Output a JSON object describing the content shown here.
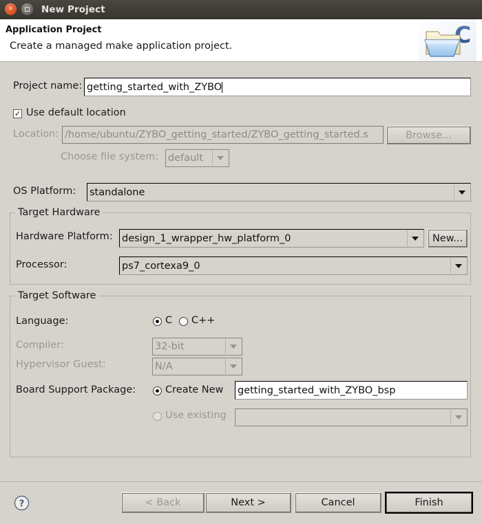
{
  "window": {
    "title": "New Project",
    "close_icon": "window-close-icon",
    "maximize_icon": "window-maximize-icon"
  },
  "header": {
    "title": "Application Project",
    "subtitle": "Create a managed make application project.",
    "icon": "c-project-folder-icon"
  },
  "form": {
    "project_name_label": "Project name:",
    "project_name_value": "getting_started_with_ZYBO",
    "use_default_location_label": "Use default location",
    "use_default_location_checked": true,
    "location_label": "Location:",
    "location_value": "/home/ubuntu/ZYBO_getting_started/ZYBO_getting_started.s",
    "browse_label": "Browse...",
    "choose_file_system_label": "Choose file system:",
    "choose_file_system_value": "default",
    "os_platform_label": "OS Platform:",
    "os_platform_value": "standalone"
  },
  "target_hardware": {
    "group_title": "Target Hardware",
    "hardware_platform_label": "Hardware Platform:",
    "hardware_platform_value": "design_1_wrapper_hw_platform_0",
    "new_label": "New...",
    "processor_label": "Processor:",
    "processor_value": "ps7_cortexa9_0"
  },
  "target_software": {
    "group_title": "Target Software",
    "language_label": "Language:",
    "language_c": "C",
    "language_cpp": "C++",
    "language_selected": "C",
    "compiler_label": "Compiler:",
    "compiler_value": "32-bit",
    "hypervisor_label": "Hypervisor Guest:",
    "hypervisor_value": "N/A",
    "bsp_label": "Board Support Package:",
    "bsp_create_new_label": "Create New",
    "bsp_create_new_value": "getting_started_with_ZYBO_bsp",
    "bsp_use_existing_label": "Use existing",
    "bsp_use_existing_value": "",
    "bsp_selected": "Create New"
  },
  "footer": {
    "help_icon": "help-question-icon",
    "back_label": "< Back",
    "next_label": "Next >",
    "cancel_label": "Cancel",
    "finish_label": "Finish",
    "back_enabled": false,
    "default_button": "Finish"
  },
  "colors": {
    "titlebar": "#413d38",
    "dialog_bg": "#d6d3cd",
    "header_bg": "#ffffff",
    "close_button": "#d6501f",
    "field_bg": "#ffffff",
    "disabled_text": "#8d8a84"
  }
}
